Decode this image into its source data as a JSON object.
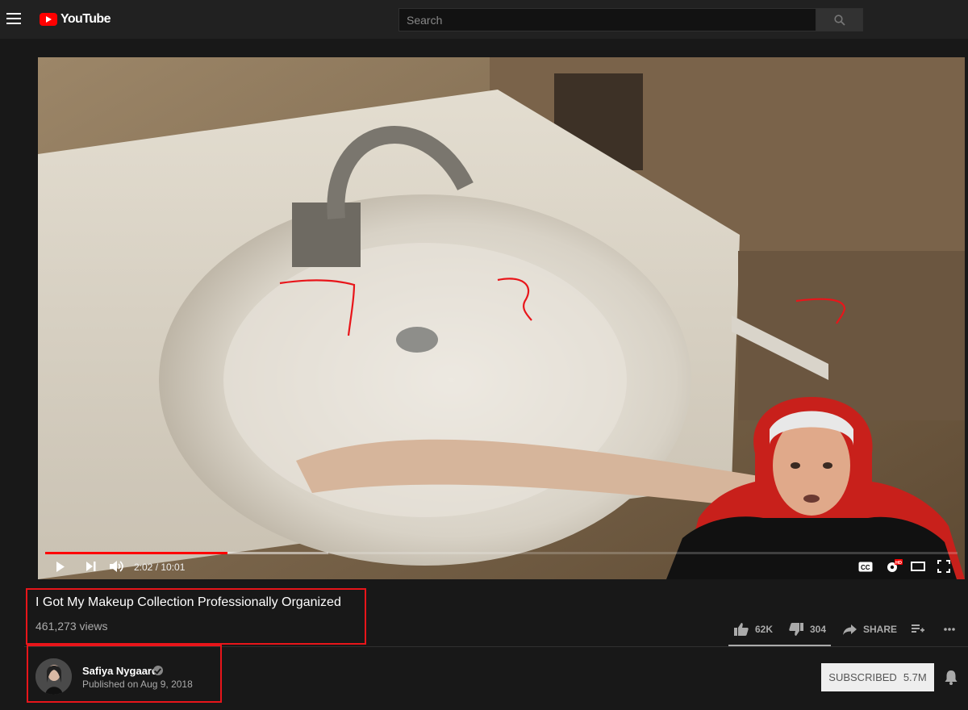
{
  "header": {
    "logo_text": "YouTube",
    "search_placeholder": "Search"
  },
  "player": {
    "current_time": "2:02",
    "duration": "10:01",
    "time_display": "2:02 / 10:01",
    "progress_fraction": 0.2,
    "buffer_fraction": 0.31
  },
  "video": {
    "title": "I Got My Makeup Collection Professionally Organized",
    "views": "461,273 views",
    "likes": "62K",
    "dislikes": "304",
    "share_label": "SHARE"
  },
  "channel": {
    "name": "Safiya Nygaard",
    "published": "Published on Aug 9, 2018",
    "subscribe_label": "SUBSCRIBED",
    "subscriber_count": "5.7M"
  },
  "colors": {
    "accent": "#ff0000",
    "annotation": "#e8151a",
    "background": "#181818"
  },
  "icons": [
    "menu-icon",
    "youtube-logo-icon",
    "search-icon",
    "play-icon",
    "next-icon",
    "volume-icon",
    "captions-icon",
    "settings-hd-icon",
    "theater-icon",
    "fullscreen-icon",
    "thumbs-up-icon",
    "thumbs-down-icon",
    "share-icon",
    "add-to-playlist-icon",
    "more-icon",
    "verified-icon",
    "bell-icon"
  ]
}
